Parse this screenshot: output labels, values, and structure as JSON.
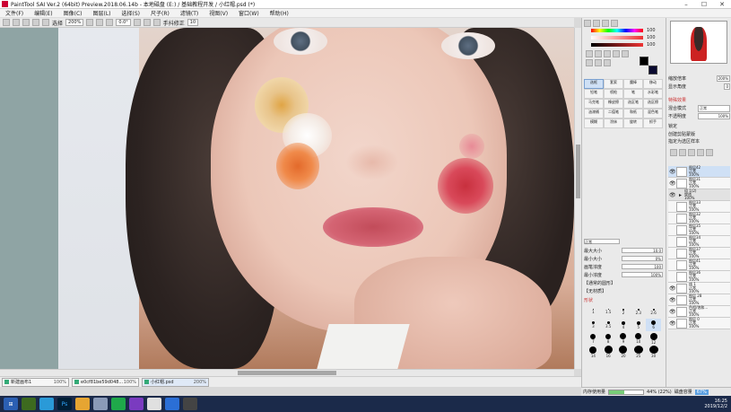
{
  "window": {
    "title": "PaintTool SAI Ver.2 (64bit) Preview.2018.06.14b - 本地磁盘 (E:) / 基础教程开发 / 小红帽.psd (*)"
  },
  "menu": [
    "文件(F)",
    "编辑(E)",
    "图像(C)",
    "图层(L)",
    "选择(S)",
    "尺子(R)",
    "滤镜(T)",
    "视图(V)",
    "窗口(W)",
    "帮助(H)"
  ],
  "toolbar": {
    "select_label": "选择",
    "zoom": "200%",
    "angle": "0.0°",
    "stabilizer_label": "手抖修正",
    "stabilizer": "10"
  },
  "colors": {
    "R": "100",
    "G": "100",
    "B": "100"
  },
  "tools": [
    "选框",
    "套索",
    "魔棒",
    "移动",
    "铅笔",
    "喷枪",
    "笔",
    "水彩笔",
    "马克笔",
    "橡皮擦",
    "选区笔",
    "选区擦",
    "油漆桶",
    "二值笔",
    "和纸",
    "混色笔",
    "模糊",
    "涂抹",
    "旋转",
    "抓手"
  ],
  "brush_props": {
    "mode": "正常",
    "size_label": "最大大小",
    "size": "10.0",
    "min_size_label": "最小大小",
    "min_size": "0%",
    "density_label": "画笔浓度",
    "density": "100",
    "min_density_label": "最小浓度",
    "min_density": "100%",
    "section1": "【通常的圆形】",
    "section2": "【无材质】",
    "section3": "形状"
  },
  "brush_sizes": [
    "1",
    "1.5",
    "2",
    "2.3",
    "2.6",
    "3",
    "3.5",
    "4",
    "5",
    "6",
    "7",
    "8",
    "9",
    "10",
    "12",
    "14",
    "16",
    "20",
    "25",
    "30"
  ],
  "nav": {
    "zoom_label": "缩放倍率",
    "zoom": "200%",
    "angle_label": "显示角度",
    "angle": "0"
  },
  "layer_props": {
    "effect": "特殊效果",
    "blend_label": "混合模式",
    "blend": "正常",
    "opacity_label": "不透明度",
    "opacity": "100%",
    "protect": "锁定",
    "clip": "创建剪贴蒙版",
    "select_src": "指定为选区样本"
  },
  "layers": [
    {
      "name": "图层42",
      "mode": "正常",
      "op": "100%"
    },
    {
      "name": "图层31",
      "mode": "正常",
      "op": "100%"
    },
    {
      "name": "组 1(2)",
      "mode": "穿透",
      "op": "100%"
    },
    {
      "name": "图层33",
      "mode": "正常",
      "op": "100%"
    },
    {
      "name": "图层32",
      "mode": "正常",
      "op": "100%"
    },
    {
      "name": "图层35",
      "mode": "正常",
      "op": "100%"
    },
    {
      "name": "图层34",
      "mode": "正常",
      "op": "100%"
    },
    {
      "name": "图层37",
      "mode": "正常",
      "op": "100%"
    },
    {
      "name": "图层41",
      "mode": "正常",
      "op": "100%"
    },
    {
      "name": "图层36",
      "mode": "正常",
      "op": "100%"
    },
    {
      "name": "线 1",
      "mode": "正常",
      "op": "100%"
    },
    {
      "name": "图层 28",
      "mode": "正常",
      "op": "100%"
    },
    {
      "name": "色相/饱和...",
      "mode": "正常",
      "op": "100%"
    },
    {
      "name": "图层 0",
      "mode": "正常",
      "op": "100%"
    }
  ],
  "docs": [
    {
      "name": "新建画布1",
      "pct": "100%"
    },
    {
      "name": "e0cf81be59d048...",
      "pct": "100%"
    },
    {
      "name": "小红帽.psd",
      "pct": "200%"
    }
  ],
  "status": {
    "mem_label": "内存使用量",
    "mem": "44% (22%)",
    "mem_fraction": 0.44,
    "disk_label": "磁盘容量",
    "disk": "67%"
  },
  "tray": {
    "time": "16:25",
    "date": "2019/12/2"
  }
}
